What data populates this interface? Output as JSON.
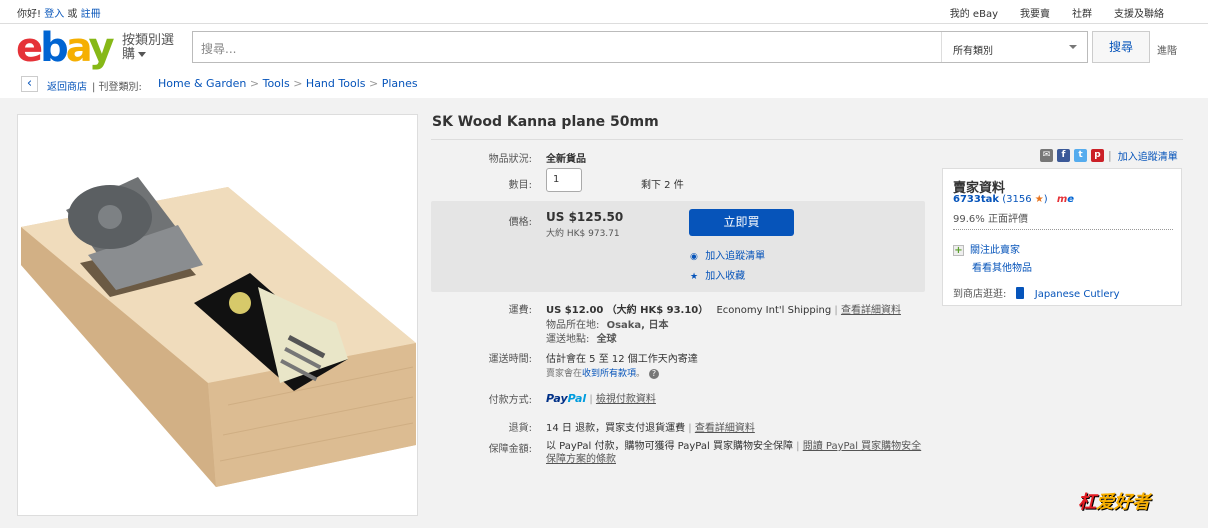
{
  "topbar": {
    "greeting": "你好!",
    "signin": "登入",
    "or": "或",
    "register": "註冊",
    "links": [
      "我的 eBay",
      "我要賣",
      "社群",
      "支援及聯絡"
    ]
  },
  "header": {
    "logo": [
      "e",
      "b",
      "a",
      "y"
    ],
    "shop_by_category": "按類別選購",
    "search_placeholder": "搜尋...",
    "category_select": "所有類別",
    "search_button": "搜尋",
    "advanced": "進階"
  },
  "breadcrumb": {
    "back": "返回商店",
    "listed_in": "| 刊登類別:",
    "path": [
      "Home & Garden",
      "Tools",
      "Hand Tools",
      "Planes"
    ]
  },
  "item": {
    "title": "SK Wood Kanna plane 50mm",
    "condition_label": "物品狀況:",
    "condition": "全新貨品",
    "quantity_label": "數目:",
    "quantity": "1",
    "remaining": "剩下 2 件",
    "price_label": "價格:",
    "price": "US $125.50",
    "price_approx": "大約 HK$ 973.71",
    "buy_now": "立即買",
    "add_watch": "加入追蹤清單",
    "add_collection": "加入收藏",
    "shipping_label": "運費:",
    "shipping_cost": "US $12.00",
    "shipping_approx": "（大約 HK$ 93.10）",
    "shipping_service": "Economy Int'l Shipping",
    "see_details": "查看詳細資料",
    "location_label": "物品所在地:",
    "location": "Osaka, 日本",
    "ships_to_label": "運送地點:",
    "ships_to": "全球",
    "delivery_label": "運送時間:",
    "delivery": "估計會在 5 至 12 個工作天內寄達",
    "delivery_note_a": "賣家會在",
    "delivery_note_link": "收到所有款項",
    "delivery_note_b": "。",
    "payment_label": "付款方式:",
    "paypal_a": "Pay",
    "paypal_b": "Pal",
    "payment_details": "檢視付款資料",
    "returns_label": "退貨:",
    "returns": "14 日 退款，買家支付退貨運費",
    "returns_details": "查看詳細資料",
    "guarantee_label": "保障金額:",
    "guarantee": "以 PayPal 付款，購物可獲得 PayPal 買家購物安全保障",
    "guarantee_link": "閱讀 PayPal 買家購物安全保障方案的條款"
  },
  "share": {
    "watch_list": "加入追蹤清單"
  },
  "seller": {
    "heading": "賣家資料",
    "name": "6733tak",
    "score": "(3156",
    "positive": "99.6% 正面評價",
    "follow": "關注此賣家",
    "other_items": "看看其他物品",
    "visit_store": "到商店逛逛:",
    "store_name": "Japanese Cutlery"
  },
  "watermark": {
    "a": "杠",
    "b": "爱好者"
  },
  "colors": {
    "link": "#0654ba",
    "buy_button": "#0654ba",
    "star": "#e8741e"
  }
}
